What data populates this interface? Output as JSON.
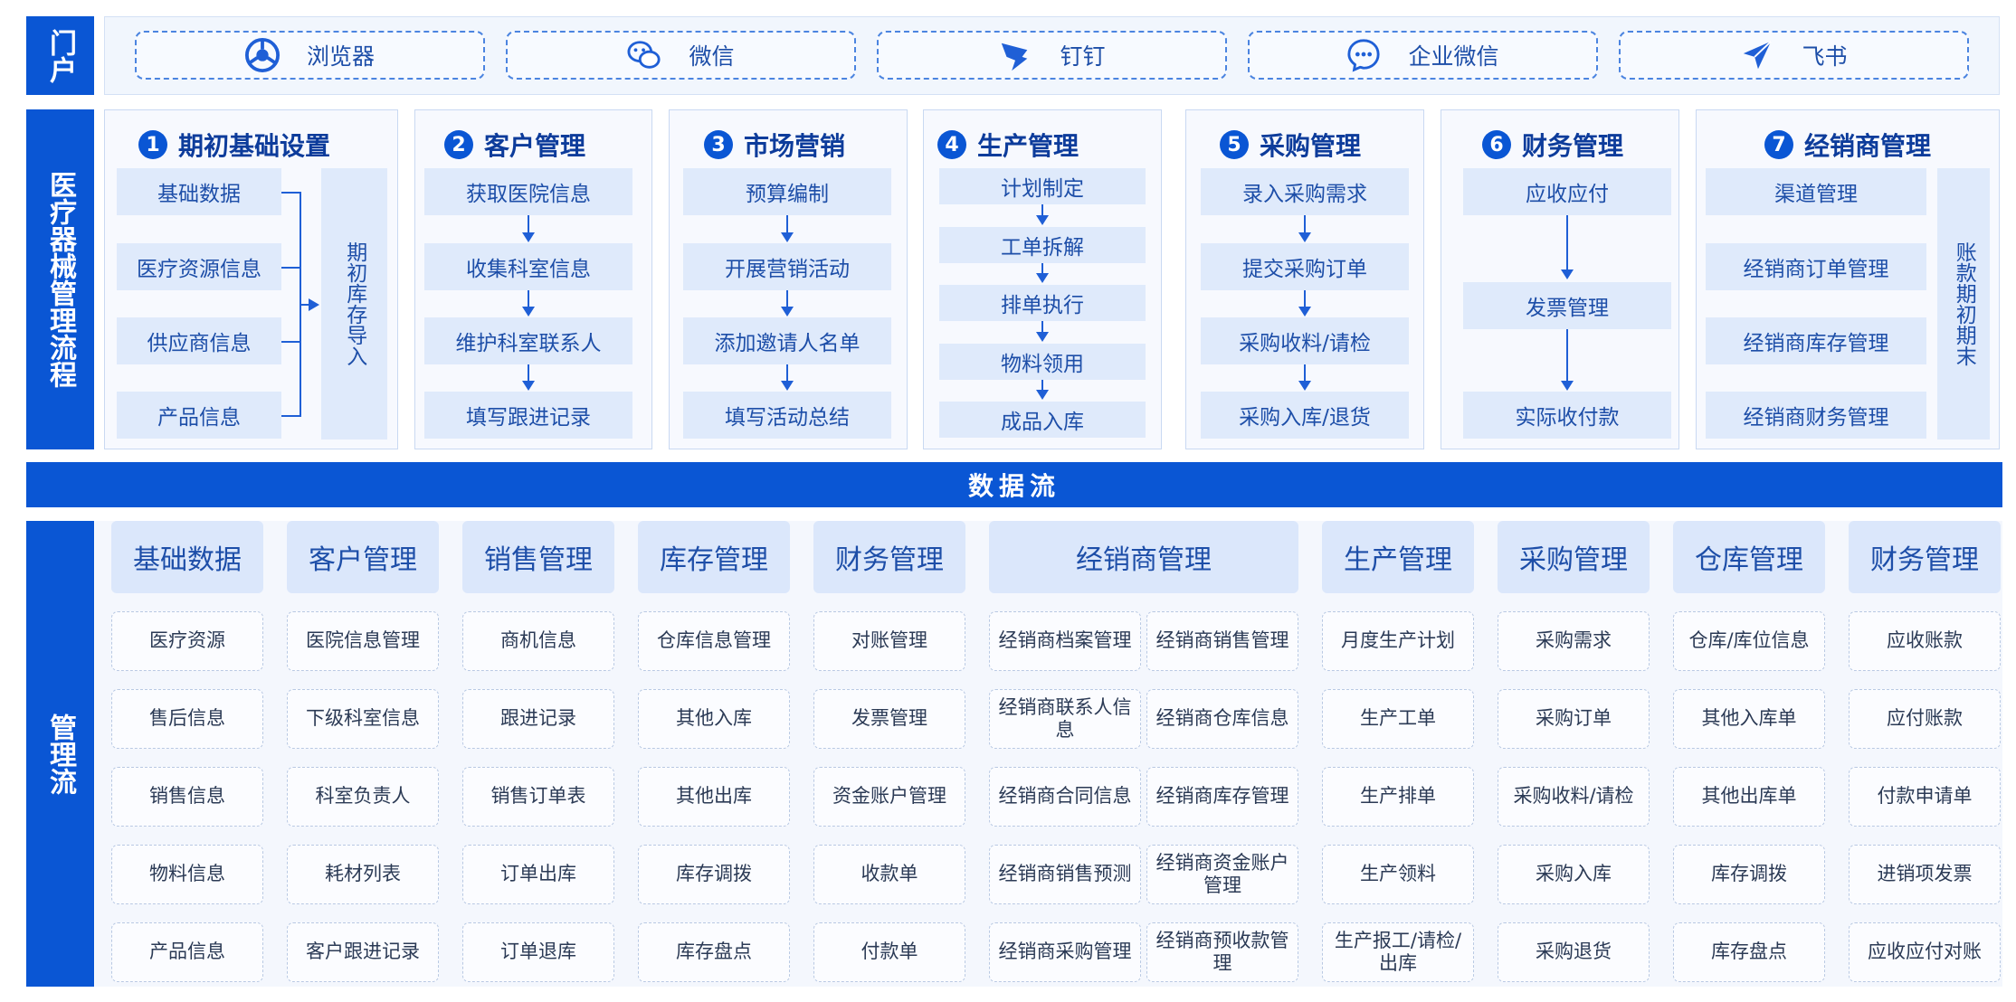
{
  "portal": {
    "label": "门户",
    "items": [
      {
        "label": "浏览器",
        "icon": "chrome-icon"
      },
      {
        "label": "微信",
        "icon": "wechat-icon"
      },
      {
        "label": "钉钉",
        "icon": "dingtalk-icon"
      },
      {
        "label": "企业微信",
        "icon": "wecom-icon"
      },
      {
        "label": "飞书",
        "icon": "feishu-icon"
      }
    ]
  },
  "process": {
    "label": "医疗器械管理流程",
    "modules": [
      {
        "num": "1",
        "title": "期初基础设置",
        "items": [
          "基础数据",
          "医疗资源信息",
          "供应商信息",
          "产品信息"
        ],
        "side": "期初库存导入"
      },
      {
        "num": "2",
        "title": "客户管理",
        "items": [
          "获取医院信息",
          "收集科室信息",
          "维护科室联系人",
          "填写跟进记录"
        ]
      },
      {
        "num": "3",
        "title": "市场营销",
        "items": [
          "预算编制",
          "开展营销活动",
          "添加邀请人名单",
          "填写活动总结"
        ]
      },
      {
        "num": "4",
        "title": "生产管理",
        "items": [
          "计划制定",
          "工单拆解",
          "排单执行",
          "物料领用",
          "成品入库"
        ]
      },
      {
        "num": "5",
        "title": "采购管理",
        "items": [
          "录入采购需求",
          "提交采购订单",
          "采购收料/请检",
          "采购入库/退货"
        ]
      },
      {
        "num": "6",
        "title": "财务管理",
        "items": [
          "应收应付",
          "发票管理",
          "实际收付款"
        ]
      },
      {
        "num": "7",
        "title": "经销商管理",
        "items": [
          "渠道管理",
          "经销商订单管理",
          "经销商库存管理",
          "经销商财务管理"
        ],
        "side": "账款期初期末"
      }
    ]
  },
  "dataflow": {
    "label": "数据流"
  },
  "management": {
    "label": "管理流",
    "columns": [
      {
        "header": "基础数据",
        "cells": [
          "医疗资源",
          "售后信息",
          "销售信息",
          "物料信息",
          "产品信息"
        ]
      },
      {
        "header": "客户管理",
        "cells": [
          "医院信息管理",
          "下级科室信息",
          "科室负责人",
          "耗材列表",
          "客户跟进记录"
        ]
      },
      {
        "header": "销售管理",
        "cells": [
          "商机信息",
          "跟进记录",
          "销售订单表",
          "订单出库",
          "订单退库"
        ]
      },
      {
        "header": "库存管理",
        "cells": [
          "仓库信息管理",
          "其他入库",
          "其他出库",
          "库存调拨",
          "库存盘点"
        ]
      },
      {
        "header": "财务管理",
        "cells": [
          "对账管理",
          "发票管理",
          "资金账户管理",
          "收款单",
          "付款单"
        ]
      },
      {
        "header": "经销商管理",
        "cells": [
          "经销商档案管理",
          "经销商销售管理",
          "经销商联系人信息",
          "经销商仓库信息",
          "经销商合同信息",
          "经销商库存管理",
          "经销商销售预测",
          "经销商资金账户管理",
          "经销商采购管理",
          "经销商预收款管理"
        ]
      },
      {
        "header": "生产管理",
        "cells": [
          "月度生产计划",
          "生产工单",
          "生产排单",
          "生产领料",
          "生产报工/请检/出库"
        ]
      },
      {
        "header": "采购管理",
        "cells": [
          "采购需求",
          "采购订单",
          "采购收料/请检",
          "采购入库",
          "采购退货"
        ]
      },
      {
        "header": "仓库管理",
        "cells": [
          "仓库/库位信息",
          "其他入库单",
          "其他出库单",
          "库存调拨",
          "库存盘点"
        ]
      },
      {
        "header": "财务管理",
        "cells": [
          "应收账款",
          "应付账款",
          "付款申请单",
          "进销项发票",
          "应收应付对账"
        ]
      }
    ]
  }
}
